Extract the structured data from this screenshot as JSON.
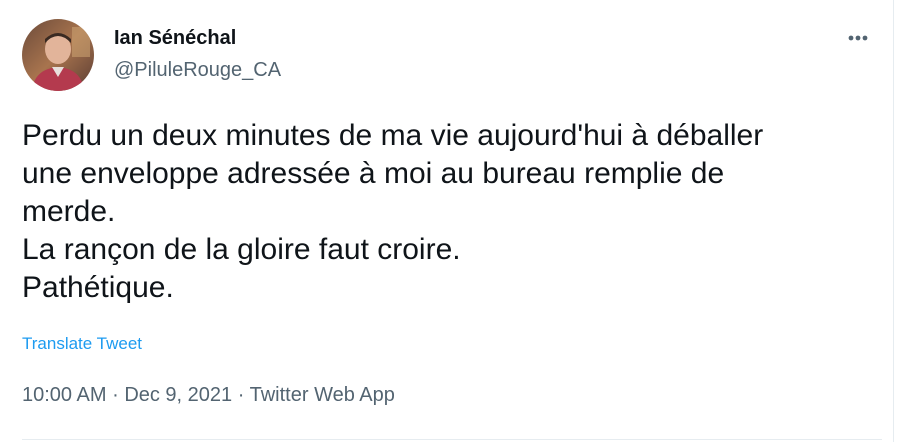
{
  "author": {
    "display_name": "Ian Sénéchal",
    "handle": "@PiluleRouge_CA"
  },
  "tweet": {
    "text": "Perdu un deux minutes de ma vie aujourd'hui à déballer\nune enveloppe adressée à moi au bureau remplie de\nmerde.\nLa rançon de la gloire faut croire.\nPathétique.",
    "translate_label": "Translate Tweet",
    "time": "10:00 AM",
    "separator": "·",
    "date": "Dec 9, 2021",
    "source": "Twitter Web App"
  },
  "icons": {
    "avatar": "avatar-photo",
    "more": "more-horizontal-icon"
  },
  "colors": {
    "text_primary": "#0f1419",
    "text_secondary": "#536471",
    "link": "#1d9bf0",
    "divider": "#e6ecf0"
  }
}
